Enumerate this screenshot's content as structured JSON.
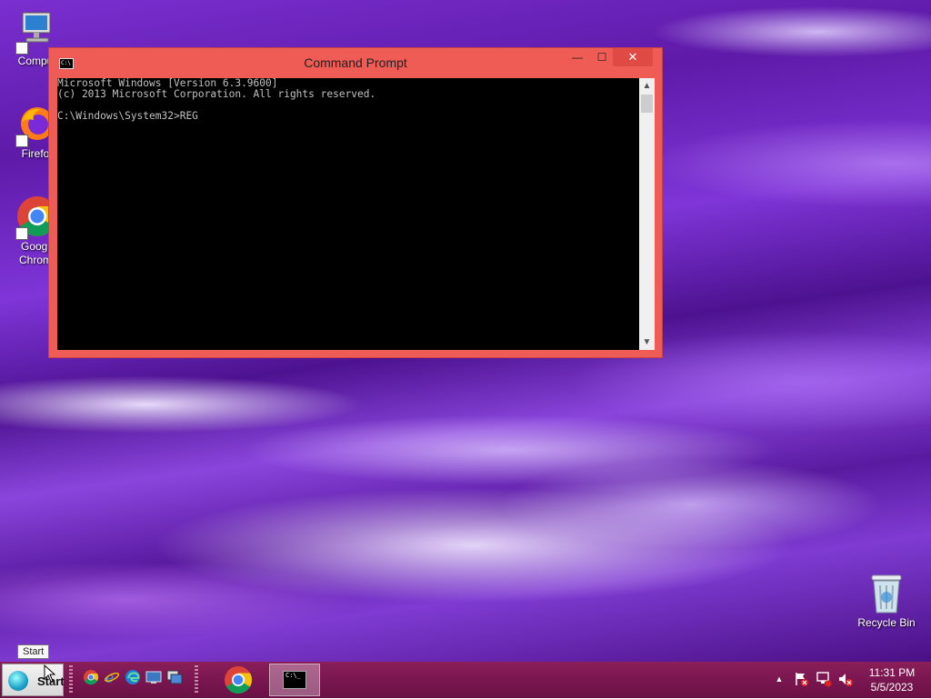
{
  "desktop": {
    "icons": [
      {
        "label": "Compu",
        "icon": "computer-icon"
      },
      {
        "label": "Firefo",
        "icon": "firefox-icon"
      },
      {
        "label": "Googl",
        "label2": "Chrom",
        "icon": "chrome-icon"
      },
      {
        "label": "Recycle Bin",
        "icon": "recycle-bin-icon"
      }
    ]
  },
  "cmd_window": {
    "title": "Command Prompt",
    "icon_text": "C:\\",
    "buttons": {
      "minimize": "—",
      "maximize": "☐",
      "close": "✕"
    },
    "lines": [
      "Microsoft Windows [Version 6.3.9600]",
      "(c) 2013 Microsoft Corporation. All rights reserved.",
      "",
      "C:\\Windows\\System32>REG"
    ]
  },
  "taskbar": {
    "start_label": "Start",
    "start_tooltip": "Start",
    "quick_launch": [
      "chrome-icon",
      "ie-icon",
      "edge-icon",
      "desktop-icon",
      "window-switch-icon"
    ],
    "pinned": [
      "chrome-icon",
      "cmd-icon"
    ],
    "cmd_icon_text": "C:\\_",
    "tray": [
      "show-hidden-icons-icon",
      "action-center-flag-icon",
      "network-icon",
      "volume-muted-icon"
    ],
    "time": "11:31 PM",
    "date": "5/5/2023"
  }
}
